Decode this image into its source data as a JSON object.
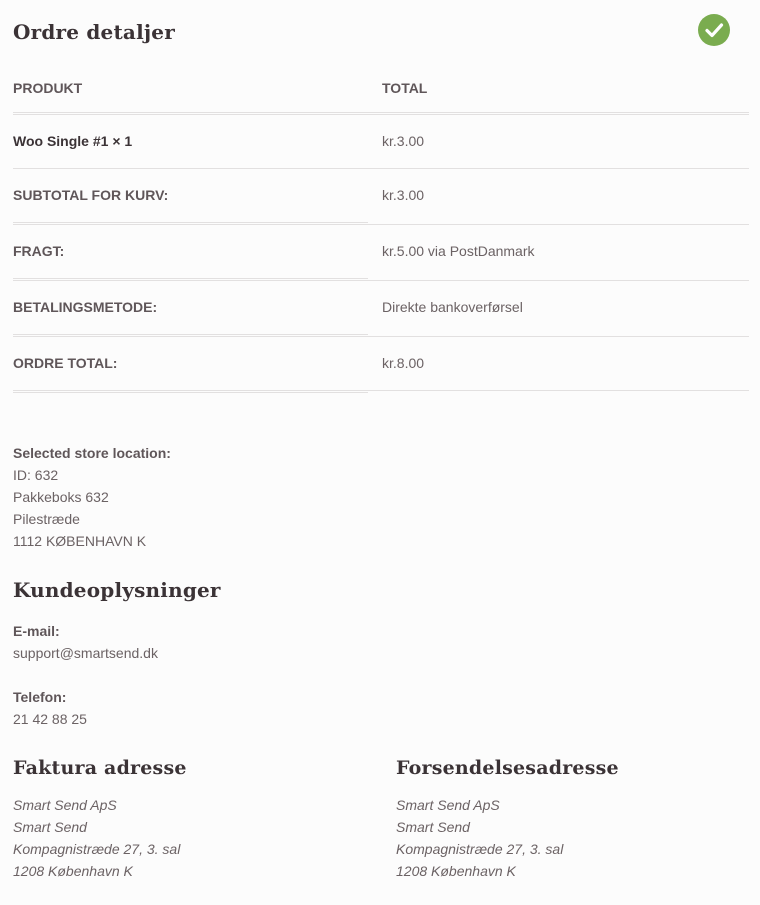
{
  "order": {
    "title": "Ordre detaljer",
    "columns": {
      "product": "PRODUKT",
      "total": "TOTAL"
    },
    "item": {
      "name": "Woo Single #1",
      "qty": "× 1",
      "total": "kr.3.00"
    },
    "rows": [
      {
        "label": "SUBTOTAL FOR KURV:",
        "value": "kr.3.00"
      },
      {
        "label": "FRAGT:",
        "value": "kr.5.00 via PostDanmark"
      },
      {
        "label": "BETALINGSMETODE:",
        "value": "Direkte bankoverførsel"
      },
      {
        "label": "ORDRE TOTAL:",
        "value": "kr.8.00"
      }
    ]
  },
  "store": {
    "title": "Selected store location:",
    "lines": [
      "ID: 632",
      "Pakkeboks 632",
      "Pilestræde",
      "1112 KØBENHAVN K"
    ]
  },
  "customer": {
    "title": "Kundeoplysninger",
    "email_label": "E-mail:",
    "email": "support@smartsend.dk",
    "phone_label": "Telefon:",
    "phone": "21 42 88 25"
  },
  "billing": {
    "title": "Faktura adresse",
    "lines": [
      "Smart Send ApS",
      "Smart Send",
      "Kompagnistræde 27, 3. sal",
      "1208 København K"
    ]
  },
  "shipping": {
    "title": "Forsendelsesadresse",
    "lines": [
      "Smart Send ApS",
      "Smart Send",
      "Kompagnistræde 27, 3. sal",
      "1208 København K"
    ]
  },
  "colors": {
    "accent_green": "#7aac4f",
    "heading": "#3b3336",
    "text": "#6b6264"
  },
  "icons": {
    "status": "checkmark-icon"
  }
}
